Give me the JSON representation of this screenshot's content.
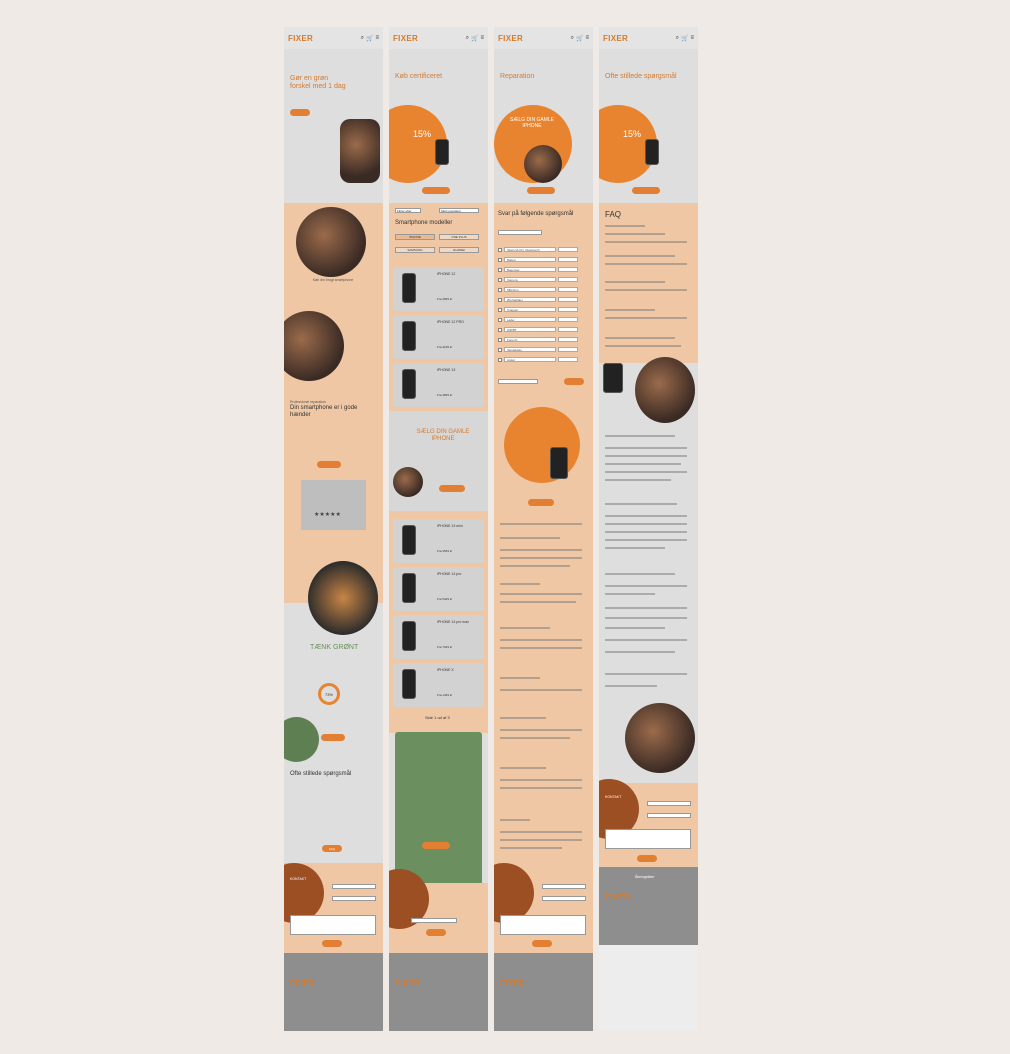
{
  "brand": "FIXER",
  "columns": [
    {
      "name": "home",
      "hero_title": "Gør en grøn forskel med 1 dag",
      "product_caption": "Køb din brugt smartphone",
      "section_label": "Professionel reparation",
      "section_title": "Din smartphone er i gode hænder",
      "testimonial_rating": "★★★★★",
      "eco_title": "TÆNK GRØNT",
      "eco_percent": "73%",
      "faq_title": "Ofte stillede spørgsmål",
      "faq_button": "FAQ",
      "contact_title": "KONTAKT"
    },
    {
      "name": "shop",
      "hero_title": "Køb certificeret",
      "discount_value": "15%",
      "filter_1": "Filtrer efter",
      "filter_2": "Mest populære",
      "models_title": "Smartphone modeller",
      "brands": [
        "IPHONE",
        "ONE PLUS",
        "SAMSUNG",
        "HUAWEI"
      ],
      "sell_title": "SÆLG DIN GAMLE IPHONE",
      "products": [
        {
          "name": "IPHONE 12",
          "price": "Fra 2849 kr"
        },
        {
          "name": "IPHONE 12 PRO",
          "price": "Fra 3199 kr"
        },
        {
          "name": "IPHONE 13",
          "price": "Fra 3849 kr"
        },
        {
          "name": "IPHONE 13 mini",
          "price": "Fra 3549 kr"
        },
        {
          "name": "IPHONE 14 pro",
          "price": "Fra 5449 kr"
        },
        {
          "name": "IPHONE 14 pro max",
          "price": "Fra 7349 kr"
        },
        {
          "name": "IPHONE X",
          "price": "Fra 1449 kr"
        }
      ],
      "pager": "Side 1 ud af 3"
    },
    {
      "name": "repair",
      "hero_title": "Reparation",
      "sell_title": "SÆLG DIN GAMLE IPHONE",
      "questions_title": "Svar på følgende spørgsmål",
      "options": [
        "Skærm/LCD, Glas/touch",
        "Batteri",
        "Bagcover",
        "Kamera",
        "Mikrofon",
        "Ørehøjttaler",
        "Knapper",
        "Lader",
        "Wifi/BT",
        "Face ID",
        "Vandskade",
        "Andet"
      ]
    },
    {
      "name": "faq",
      "hero_title": "Ofte stillede spørgsmål",
      "discount_value": "15%",
      "faq_title": "FAQ",
      "contact_title": "KONTAKT",
      "footer_title": "Åbningstider"
    }
  ]
}
